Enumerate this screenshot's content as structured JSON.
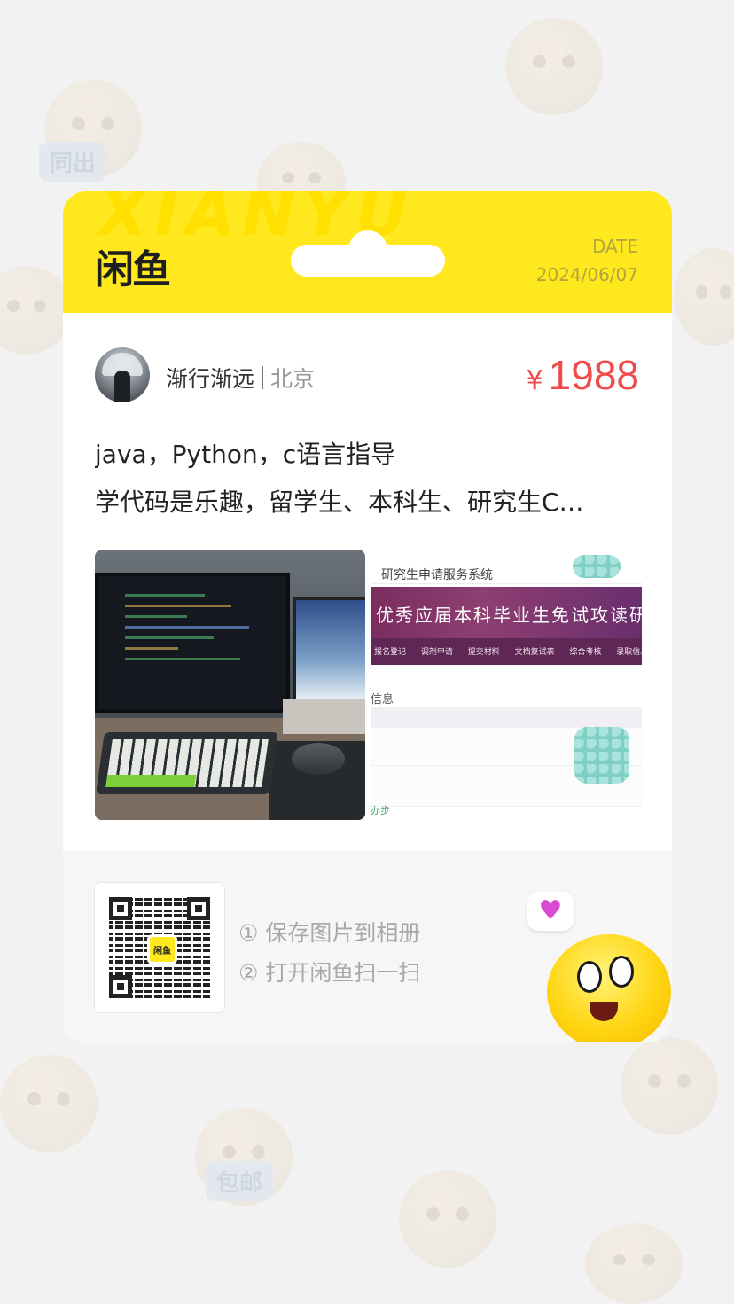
{
  "brand": {
    "logo_text": "闲鱼",
    "watermark": "XIANYU"
  },
  "header": {
    "date_label": "DATE",
    "date_value": "2024/06/07"
  },
  "seller": {
    "name": "渐行渐远",
    "city": "北京"
  },
  "price": {
    "currency_symbol": "¥",
    "amount": "1988"
  },
  "listing": {
    "title_line_1": "java，Python，c语言指导",
    "title_line_2": "学代码是乐趣，留学生、本科生、研究生C…"
  },
  "right_photo": {
    "site_title": "研究生申请服务系统",
    "banner_text": "优秀应届本科毕业生免试攻读研究生申",
    "nav_items": "报名登记 调剂申请 提交材料 文档复试表 综合考核 录取信息",
    "section_heading": "信息",
    "footer_text": "办步"
  },
  "footer": {
    "step_1": "① 保存图片到相册",
    "step_2": "② 打开闲鱼扫一扫",
    "qr_logo_text": "闲鱼"
  },
  "mascot": {
    "bubble_icon": "heart-icon"
  },
  "colors": {
    "brand_yellow": "#ffe81d",
    "price_red": "#f04a4a",
    "date_text": "#b3a53d",
    "background": "#f2f2f2"
  }
}
